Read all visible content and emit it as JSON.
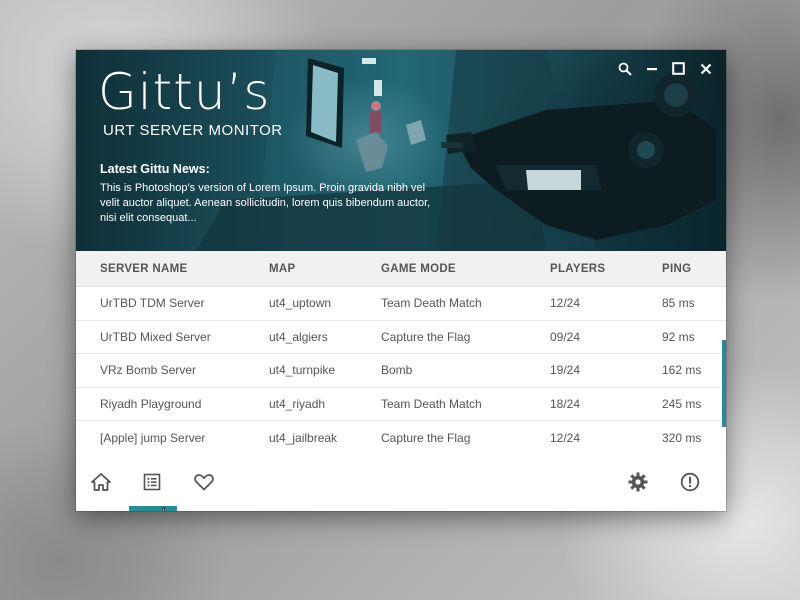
{
  "app": {
    "title": "Gittu’s",
    "subtitle": "URT SERVER MONITOR"
  },
  "news": {
    "heading": "Latest Gittu News:",
    "body": "This is Photoshop’s version  of Lorem Ipsum. Proin gravida nibh vel velit auctor aliquet. Aenean sollicitudin, lorem quis bibendum auctor, nisi elit consequat..."
  },
  "window_controls": [
    "search-icon",
    "minimize-icon",
    "maximize-icon",
    "close-icon"
  ],
  "table": {
    "headers": {
      "server_name": "SERVER NAME",
      "map": "MAP",
      "game_mode": "GAME MODE",
      "players": "PLAYERS",
      "ping": "PING"
    },
    "rows": [
      {
        "server_name": "UrTBD TDM Server",
        "map": "ut4_uptown",
        "game_mode": "Team Death Match",
        "players": "12/24",
        "ping": "85 ms"
      },
      {
        "server_name": "UrTBD Mixed Server",
        "map": "ut4_algiers",
        "game_mode": "Capture the Flag",
        "players": "09/24",
        "ping": "92 ms"
      },
      {
        "server_name": "VRz Bomb Server",
        "map": "ut4_turnpike",
        "game_mode": "Bomb",
        "players": "19/24",
        "ping": "162 ms"
      },
      {
        "server_name": "Riyadh Playground",
        "map": "ut4_riyadh",
        "game_mode": "Team Death Match",
        "players": "18/24",
        "ping": "245 ms"
      },
      {
        "server_name": "[Apple] jump Server",
        "map": "ut4_jailbreak",
        "game_mode": "Capture the Flag",
        "players": "12/24",
        "ping": "320 ms"
      }
    ]
  },
  "bottom_nav": {
    "left": [
      "home-icon",
      "list-icon",
      "heart-icon"
    ],
    "right": [
      "gear-icon",
      "info-icon"
    ],
    "active": "list-icon"
  },
  "colors": {
    "accent": "#2a8996",
    "text": "#555555",
    "header_bg": "#f1f1f1"
  }
}
